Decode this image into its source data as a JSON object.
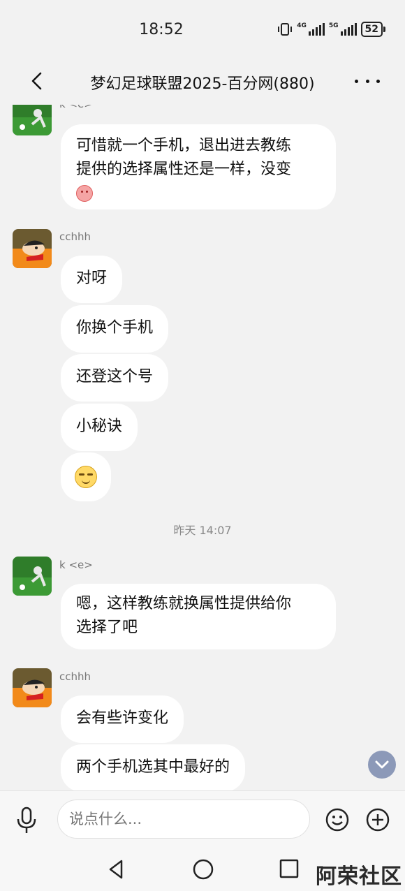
{
  "status_bar": {
    "time": "18:52",
    "network_1": "4G",
    "network_2": "5G",
    "battery": "52"
  },
  "header": {
    "title": "梦幻足球联盟2025-百分网(880)"
  },
  "chat": {
    "partial_sender": "k <e>",
    "messages": [
      {
        "text_line1": "可惜就一个手机，退出进去教练",
        "text_line2": "提供的选择属性还是一样，没变"
      },
      {
        "sender": "cchhh"
      },
      {
        "text": "对呀"
      },
      {
        "text": "你换个手机"
      },
      {
        "text": "还登这个号"
      },
      {
        "text": "小秘诀"
      },
      {
        "timestamp": "昨天 14:07"
      },
      {
        "sender": "k <e>"
      },
      {
        "text_line1": "嗯，这样教练就换属性提供给你",
        "text_line2": "选择了吧"
      },
      {
        "sender": "cchhh"
      },
      {
        "text": "会有些许变化"
      },
      {
        "text": "两个手机选其中最好的"
      }
    ]
  },
  "input": {
    "placeholder": "说点什么..."
  },
  "watermark": "阿荣社区",
  "colors": {
    "background": "#f2f2f2",
    "bubble": "#ffffff",
    "scroll_button": "#8c99b8"
  }
}
